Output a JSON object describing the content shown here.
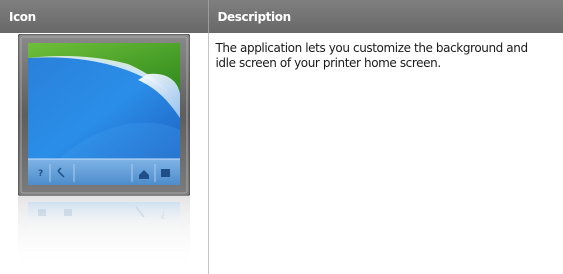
{
  "table": {
    "headers": {
      "icon": "Icon",
      "description": "Description"
    },
    "rows": [
      {
        "icon_name": "customize-display-icon",
        "description": "The application lets you customize the background and idle screen of your printer home screen."
      }
    ]
  }
}
